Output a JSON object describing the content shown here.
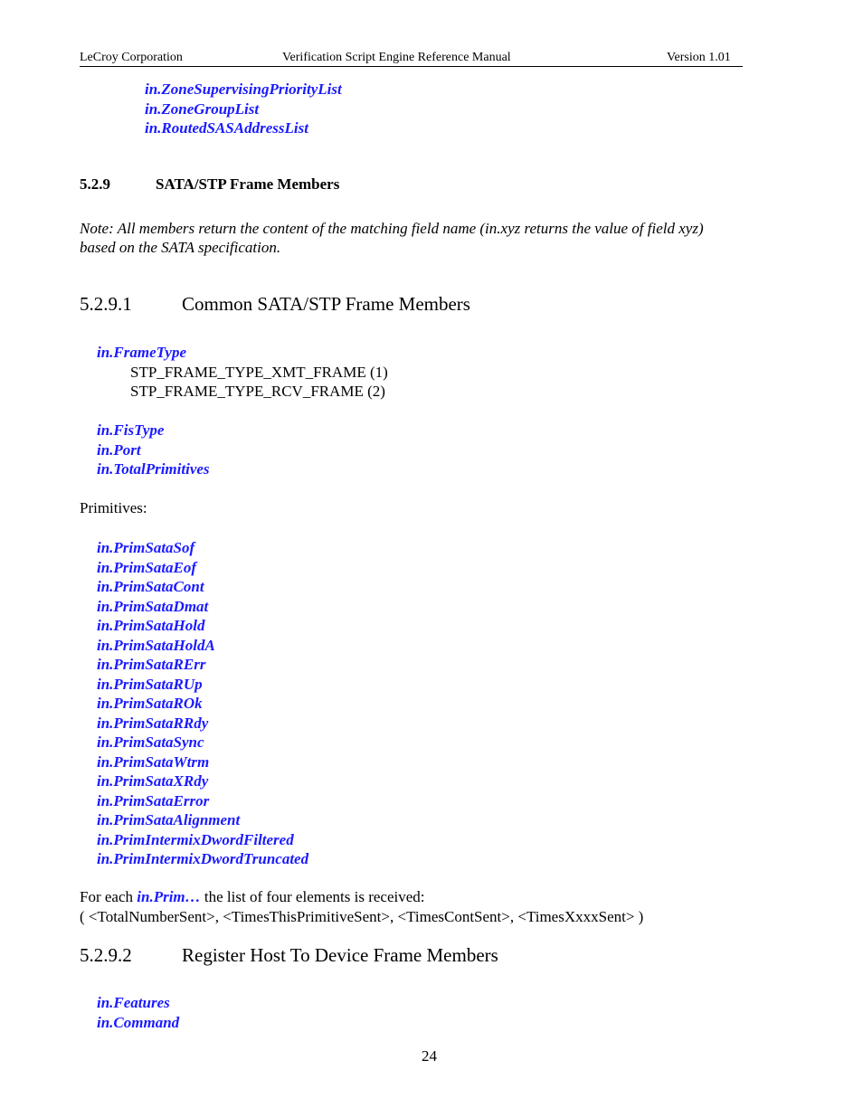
{
  "header": {
    "company": "LeCroy Corporation",
    "title": "Verification Script Engine Reference Manual",
    "version": "Version 1.01"
  },
  "top_members": [
    "in.ZoneSupervisingPriorityList",
    "in.ZoneGroupList",
    "in.RoutedSASAddressList"
  ],
  "section_529": {
    "number": "5.2.9",
    "title": "SATA/STP Frame Members",
    "note_line1": "Note: All members return the content of the matching field name (in.xyz returns the value of field xyz)",
    "note_line2": "based on the SATA specification."
  },
  "section_5291": {
    "number": "5.2.9.1",
    "title": "Common SATA/STP Frame Members",
    "frame_type": {
      "member": "in.FrameType",
      "values": [
        "STP_FRAME_TYPE_XMT_FRAME (1)",
        "STP_FRAME_TYPE_RCV_FRAME (2)"
      ]
    },
    "members": [
      "in.FisType",
      "in.Port",
      "in.TotalPrimitives"
    ],
    "primitives_label": "Primitives:",
    "primitives": [
      "in.PrimSataSof",
      "in.PrimSataEof",
      "in.PrimSataCont",
      "in.PrimSataDmat",
      "in.PrimSataHold",
      "in.PrimSataHoldA",
      "in.PrimSataRErr",
      "in.PrimSataRUp",
      "in.PrimSataROk",
      "in.PrimSataRRdy",
      "in.PrimSataSync",
      "in.PrimSataWtrm",
      "in.PrimSataXRdy",
      "in.PrimSataError",
      "in.PrimSataAlignment",
      "in.PrimIntermixDwordFiltered",
      "in.PrimIntermixDwordTruncated"
    ],
    "for_each_prefix": "For each ",
    "for_each_member": "in.Prim…",
    "for_each_suffix": " the list of four elements is received:",
    "tuple_line": "( <TotalNumberSent>, <TimesThisPrimitiveSent>, <TimesContSent>, <TimesXxxxSent> )"
  },
  "section_5292": {
    "number": "5.2.9.2",
    "title": "Register Host To Device Frame Members",
    "members": [
      "in.Features",
      "in.Command"
    ]
  },
  "footer": {
    "page_number": "24"
  },
  "colors": {
    "member_link": "#1a1aff",
    "text": "#000000"
  }
}
